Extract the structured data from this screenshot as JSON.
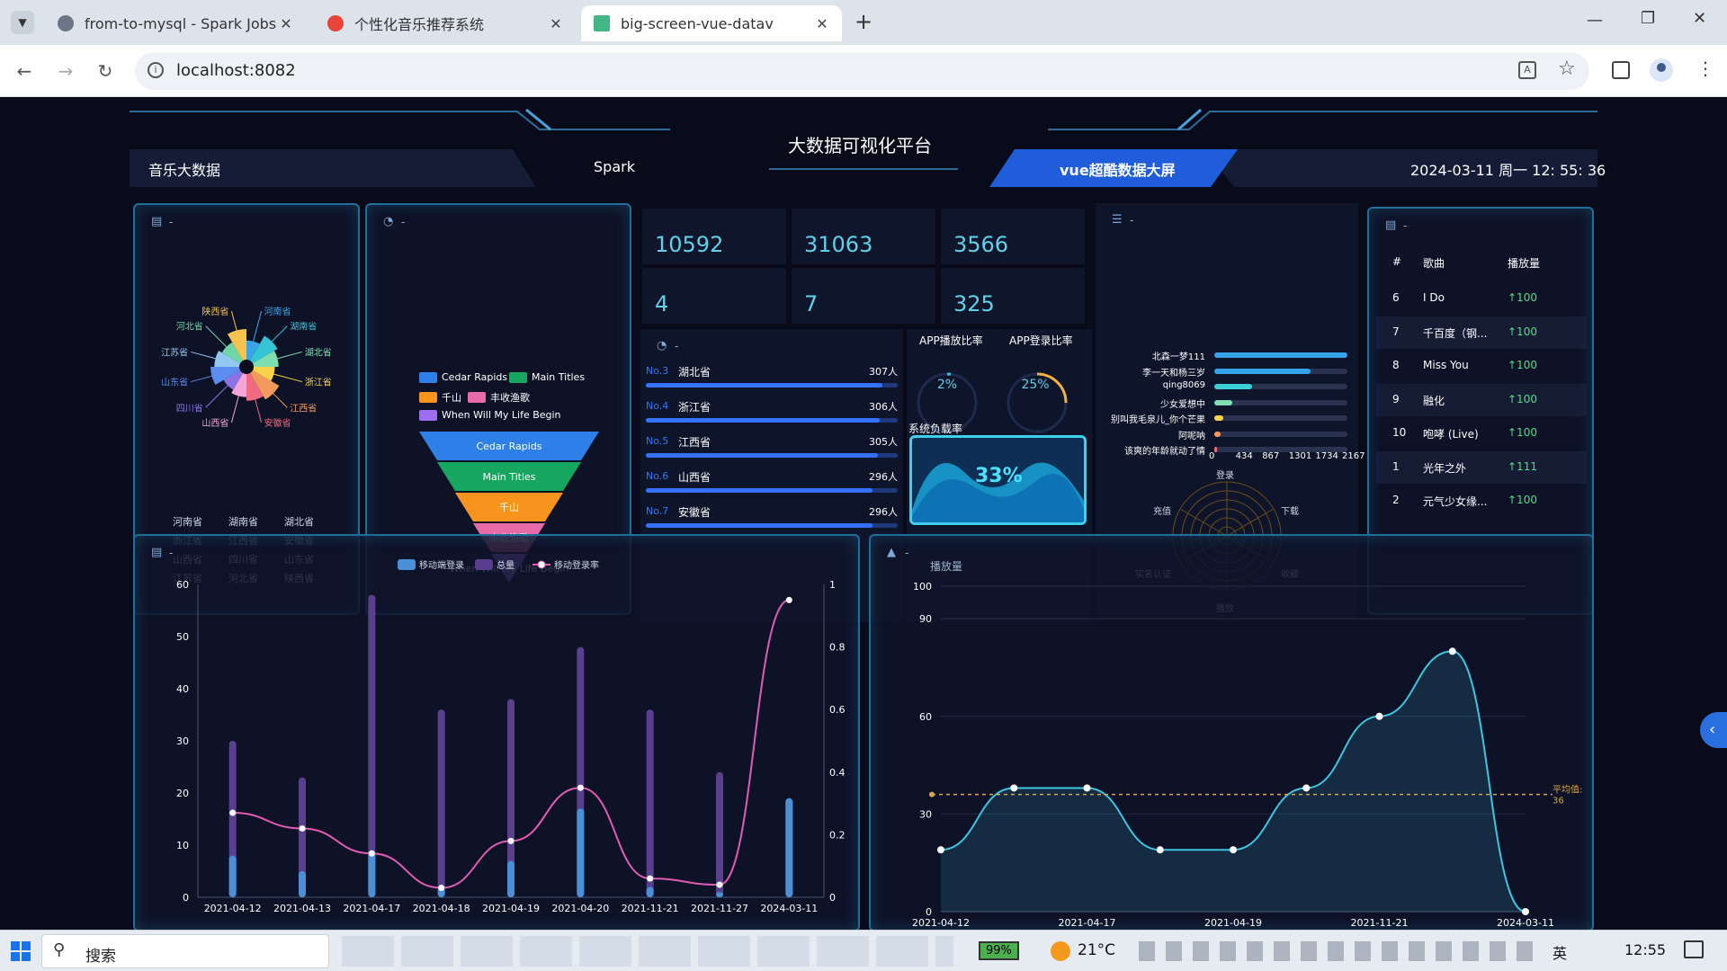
{
  "browser": {
    "tabs": [
      {
        "title": "from-to-mysql - Spark Jobs",
        "active": false
      },
      {
        "title": "个性化音乐推荐系统",
        "active": false
      },
      {
        "title": "big-screen-vue-datav",
        "active": true
      }
    ],
    "url": "localhost:8082",
    "new_tab": "+",
    "close": "✕"
  },
  "header": {
    "left": "音乐大数据",
    "spark": "Spark",
    "title": "大数据可视化平台",
    "right_tab": "vue超酷数据大屏",
    "datetime": "2024-03-11 周一 12: 55: 36"
  },
  "panel_title_placeholder": "-",
  "province_pie": {
    "slices": [
      {
        "name": "河南省",
        "color": "#3aa5e6"
      },
      {
        "name": "湖南省",
        "color": "#36c3d6"
      },
      {
        "name": "湖北省",
        "color": "#7ddfb0"
      },
      {
        "name": "浙江省",
        "color": "#f7d34b"
      },
      {
        "name": "江西省",
        "color": "#f39a5d"
      },
      {
        "name": "安徽省",
        "color": "#ef6b82"
      },
      {
        "name": "山西省",
        "color": "#f3a4d8"
      },
      {
        "name": "四川省",
        "color": "#8d72e6"
      },
      {
        "name": "山东省",
        "color": "#5b8cf0"
      },
      {
        "name": "江苏省",
        "color": "#93c7ef"
      },
      {
        "name": "河北省",
        "color": "#6fd6a6"
      },
      {
        "name": "陕西省",
        "color": "#f6c44e"
      }
    ]
  },
  "funnel": {
    "items": [
      {
        "name": "Cedar Rapids",
        "color": "#2f7fe8"
      },
      {
        "name": "Main Titles",
        "color": "#17a65f"
      },
      {
        "name": "千山",
        "color": "#f7941e"
      },
      {
        "name": "丰收渔歌",
        "color": "#e86aa6"
      },
      {
        "name": "When Will My Life Begin",
        "color": "#9e6ef0"
      }
    ]
  },
  "stats": [
    "10592",
    "31063",
    "3566",
    "4",
    "7",
    "325"
  ],
  "ranking": [
    {
      "no": "No.3",
      "prov": "湖北省",
      "count": "307人",
      "pct": 0.94
    },
    {
      "no": "No.4",
      "prov": "浙江省",
      "count": "306人",
      "pct": 0.93
    },
    {
      "no": "No.5",
      "prov": "江西省",
      "count": "305人",
      "pct": 0.92
    },
    {
      "no": "No.6",
      "prov": "山西省",
      "count": "296人",
      "pct": 0.9
    },
    {
      "no": "No.7",
      "prov": "安徽省",
      "count": "296人",
      "pct": 0.9
    }
  ],
  "gauges": {
    "play_label": "APP播放比率",
    "play_value": "2%",
    "play_pct": 0.02,
    "login_label": "APP登录比率",
    "login_value": "25%",
    "login_pct": 0.25,
    "load_label": "系统负载率",
    "load_value": "33%"
  },
  "user_bars": {
    "items": [
      {
        "name": "北森一梦111",
        "value": 2167,
        "color": "#34a3e8"
      },
      {
        "name": "李一天和杨三岁",
        "value": 1560,
        "color": "#34a3e8"
      },
      {
        "name": "qing8069",
        "value": 620,
        "color": "#3ad0d8"
      },
      {
        "name": "少女爱想中",
        "value": 300,
        "color": "#7ddfb0"
      },
      {
        "name": "别叫我毛泉儿_你个芒果",
        "value": 140,
        "color": "#f7d34b"
      },
      {
        "name": "阿呢呐",
        "value": 100,
        "color": "#f39a5d"
      },
      {
        "name": "该爽的年龄就动了情",
        "value": 40,
        "color": "#ef6b82"
      }
    ],
    "ticks": [
      "0",
      "434",
      "867",
      "1301",
      "1734",
      "2167"
    ],
    "max": 2167
  },
  "radar": {
    "labels": [
      "登录",
      "下载",
      "收藏",
      "播放",
      "实名认证",
      "充值"
    ]
  },
  "songs": {
    "headers": [
      "#",
      "歌曲",
      "播放量"
    ],
    "rows": [
      {
        "n": "6",
        "name": "I Do",
        "plays": "↑100"
      },
      {
        "n": "7",
        "name": "千百度（钢...",
        "plays": "↑100"
      },
      {
        "n": "8",
        "name": "Miss You",
        "plays": "↑100"
      },
      {
        "n": "9",
        "name": "融化",
        "plays": "↑100"
      },
      {
        "n": "10",
        "name": "咆哮 (Live)",
        "plays": "↑100"
      },
      {
        "n": "1",
        "name": "光年之外",
        "plays": "↑111"
      },
      {
        "n": "2",
        "name": "元气少女缘...",
        "plays": "↑100"
      }
    ]
  },
  "chart_data": [
    {
      "type": "bar",
      "title": "",
      "legend": [
        "移动端登录",
        "总量",
        "移动登录率"
      ],
      "categories": [
        "2021-04-12",
        "2021-04-13",
        "2021-04-17",
        "2021-04-18",
        "2021-04-19",
        "2021-04-20",
        "2021-11-21",
        "2021-11-27",
        "2024-03-11"
      ],
      "series": [
        {
          "name": "移动端登录",
          "values": [
            8,
            5,
            9,
            2,
            7,
            17,
            2,
            1,
            19
          ]
        },
        {
          "name": "总量",
          "values": [
            30,
            23,
            58,
            36,
            38,
            48,
            36,
            24,
            19
          ]
        },
        {
          "name": "移动登录率",
          "values": [
            0.27,
            0.22,
            0.14,
            0.03,
            0.18,
            0.35,
            0.06,
            0.04,
            0.95
          ]
        }
      ],
      "ylim": [
        0,
        60
      ],
      "y_ticks": [
        "0",
        "10",
        "20",
        "30",
        "40",
        "50",
        "60"
      ],
      "y2lim": [
        0,
        1
      ],
      "y2_ticks": [
        "0",
        "0.2",
        "0.4",
        "0.6",
        "0.8",
        "1"
      ],
      "colors": {
        "bar_front": "#4b8fd9",
        "bar_back": "#5a3f8f",
        "line": "#e25bb3"
      }
    },
    {
      "type": "area",
      "title": "",
      "ylabel": "播放量",
      "x": [
        "2021-04-12",
        "2021-04-17",
        "2021-04-19",
        "2021-11-21",
        "2024-03-11"
      ],
      "points": [
        {
          "x": 0,
          "y": 19
        },
        {
          "x": 0.5,
          "y": 38
        },
        {
          "x": 1,
          "y": 38
        },
        {
          "x": 1.5,
          "y": 19
        },
        {
          "x": 2,
          "y": 19
        },
        {
          "x": 2.5,
          "y": 38
        },
        {
          "x": 3,
          "y": 60
        },
        {
          "x": 3.5,
          "y": 80
        },
        {
          "x": 4,
          "y": 0
        }
      ],
      "ylim": [
        0,
        100
      ],
      "y_ticks": [
        "0",
        "30",
        "60",
        "90",
        "100"
      ],
      "average": {
        "label": "平均值:",
        "value": 36
      },
      "colors": {
        "line": "#3ec5e0",
        "avg": "#d8a84a"
      }
    }
  ],
  "taskbar": {
    "search": "搜索",
    "temp": "21°C",
    "battery": "99%",
    "time": "12:55",
    "ime": "英"
  }
}
